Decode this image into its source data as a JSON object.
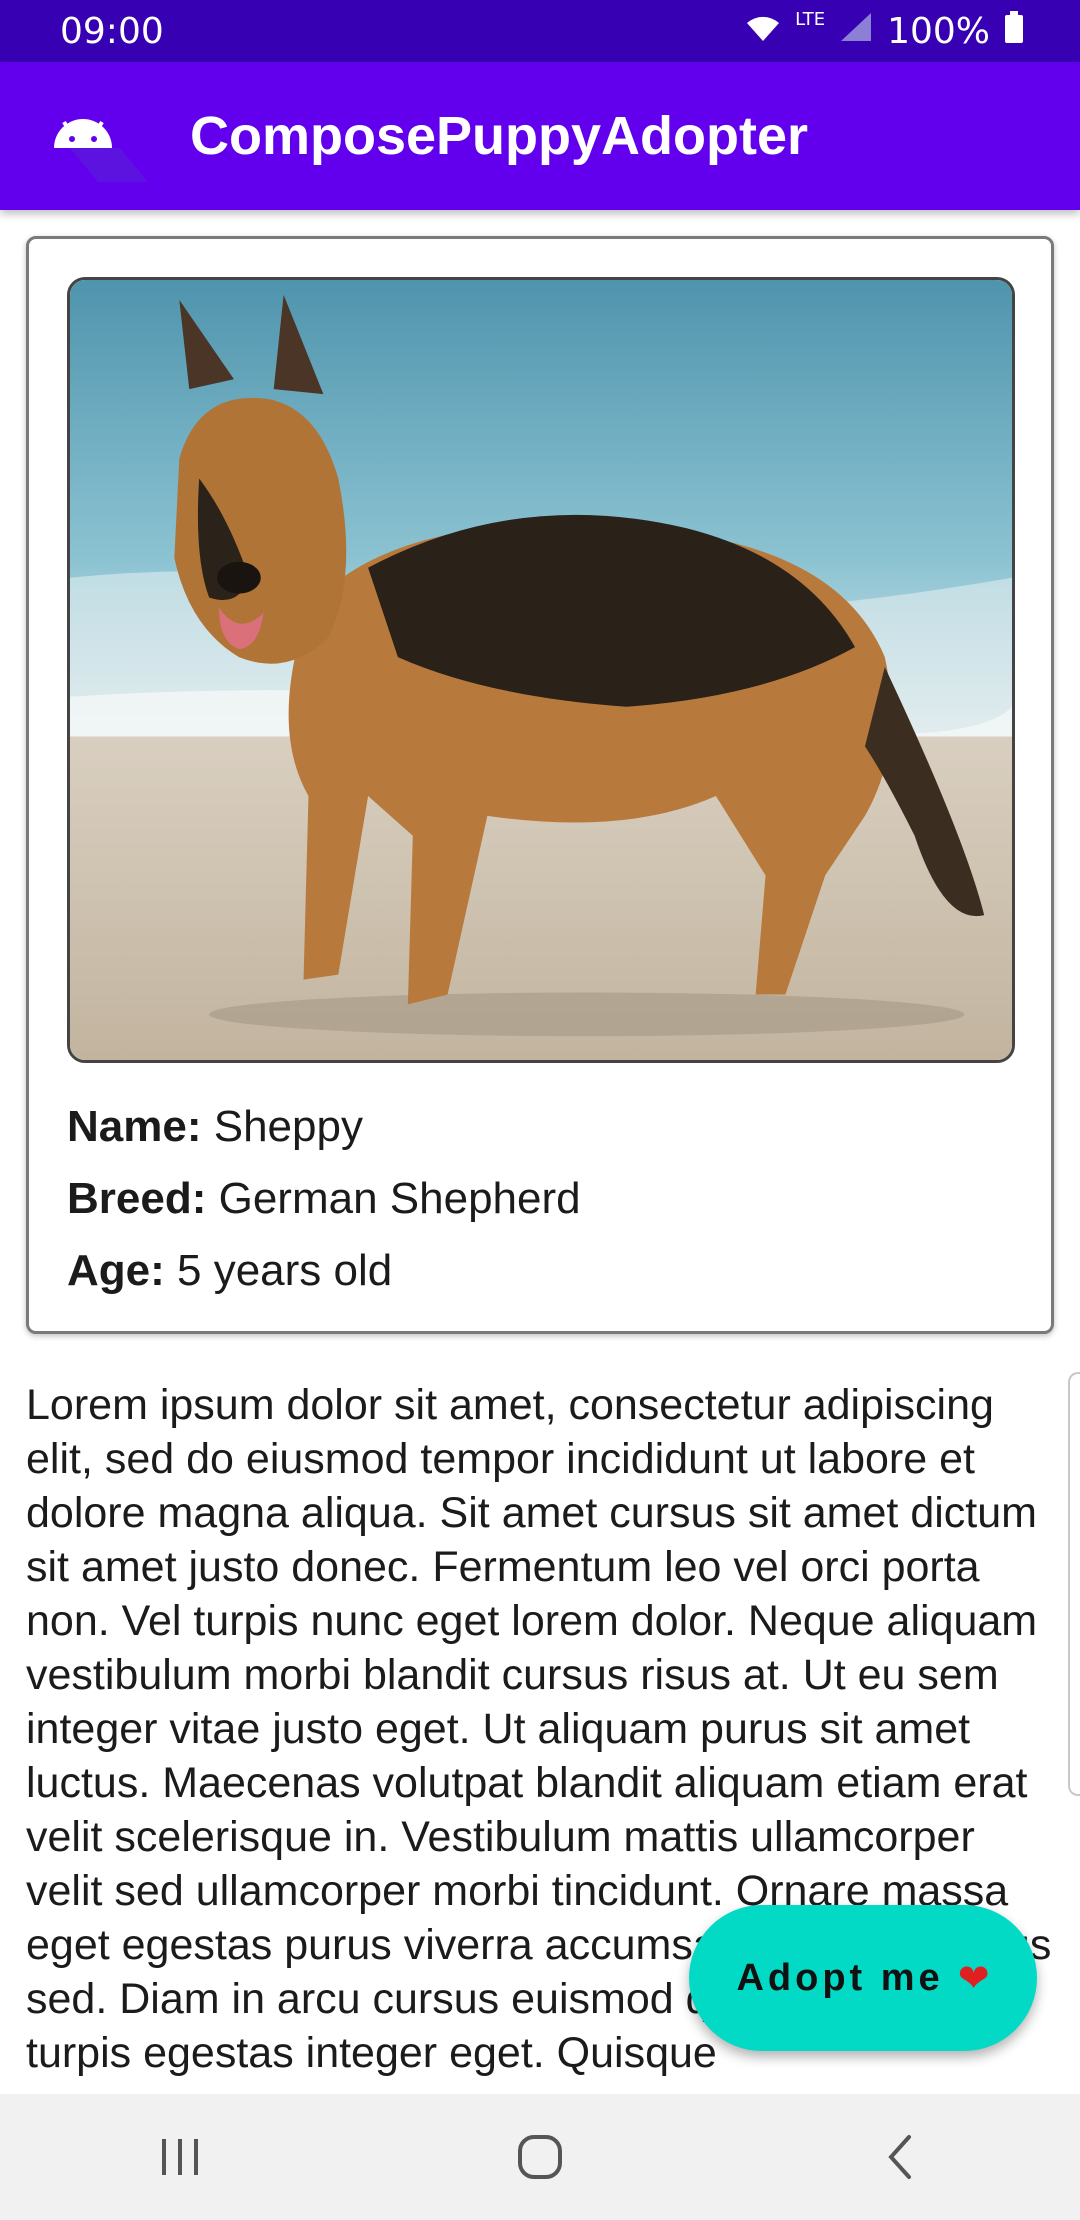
{
  "status_bar": {
    "time": "09:00",
    "network": "LTE",
    "battery": "100%"
  },
  "app_bar": {
    "title": "ComposePuppyAdopter",
    "icon": "android-icon"
  },
  "puppy": {
    "image_icon": "german-shepherd-photo",
    "name_label": "Name:",
    "name": "Sheppy",
    "breed_label": "Breed:",
    "breed": "German Shepherd",
    "age_label": "Age:",
    "age": "5 years old"
  },
  "description": "Lorem ipsum dolor sit amet, consectetur adipiscing elit, sed do eiusmod tempor incididunt ut labore et dolore magna aliqua. Sit amet cursus sit amet dictum sit amet justo donec. Fermentum leo vel orci porta non. Vel turpis nunc eget lorem dolor. Neque aliquam vestibulum morbi blandit cursus risus at. Ut eu sem integer vitae justo eget. Ut aliquam purus sit amet luctus. Maecenas volutpat blandit aliquam etiam erat velit scelerisque in. Vestibulum mattis ullamcorper velit sed ullamcorper morbi tincidunt. Ornare massa eget egestas purus viverra accumsan in nisl nisi lacus sed. Diam in arcu cursus euismod quis. Fames ac turpis egestas integer eget. Quisque",
  "fab": {
    "label": "Adopt me",
    "heart": "❤"
  },
  "nav_bar": {
    "recents_icon": "recents-icon",
    "home_icon": "home-icon",
    "back_icon": "back-icon"
  },
  "colors": {
    "status_bar": "#3700b3",
    "app_bar": "#6200ee",
    "fab": "#03dac5"
  }
}
